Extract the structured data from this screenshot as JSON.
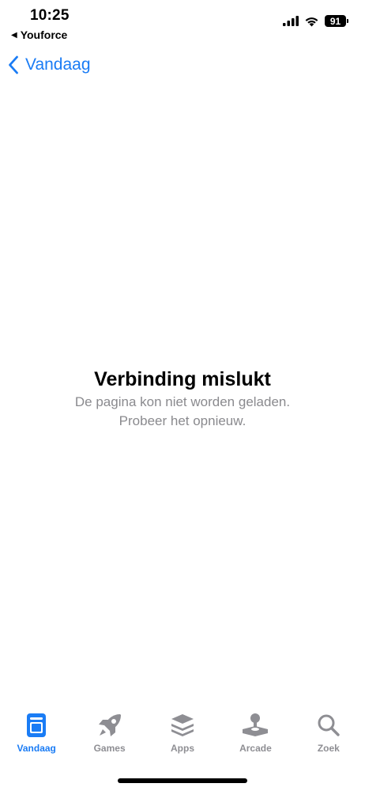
{
  "status_bar": {
    "time": "10:25",
    "back_app": "Youforce",
    "battery": "91"
  },
  "nav": {
    "back_label": "Vandaag"
  },
  "error": {
    "title": "Verbinding mislukt",
    "line1": "De pagina kon niet worden geladen.",
    "line2": "Probeer het opnieuw."
  },
  "tabs": [
    {
      "label": "Vandaag",
      "icon": "today-icon",
      "active": true
    },
    {
      "label": "Games",
      "icon": "rocket-icon",
      "active": false
    },
    {
      "label": "Apps",
      "icon": "apps-stack-icon",
      "active": false
    },
    {
      "label": "Arcade",
      "icon": "joystick-icon",
      "active": false
    },
    {
      "label": "Zoek",
      "icon": "search-icon",
      "active": false
    }
  ],
  "colors": {
    "accent": "#1a7cf5",
    "inactive": "#8e8e93",
    "subtitle": "#8a8a8e"
  }
}
